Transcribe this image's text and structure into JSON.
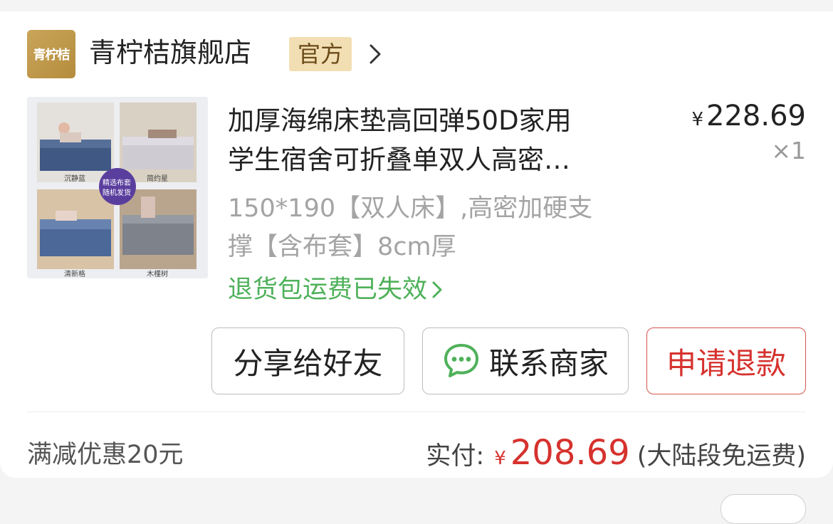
{
  "store": {
    "logo_text": "青柠桔",
    "name": "青柠桔旗舰店",
    "badge": "官方"
  },
  "product": {
    "title_line1": "加厚海绵床垫高回弹50D家用",
    "title_line2": "学生宿舍可折叠单双人高密…",
    "price_symbol": "¥",
    "price": "228.69",
    "quantity": "×1",
    "spec_line1": "150*190【双人床】,高密加硬支",
    "spec_line2": "撑【含布套】8cm厚",
    "return_notice": "退货包运费已失效",
    "image_labels": [
      "沉静蓝",
      "简约星",
      "精选布套",
      "随机发货",
      "清新格",
      "木槿树"
    ]
  },
  "actions": {
    "share": "分享给好友",
    "contact": "联系商家",
    "refund": "申请退款"
  },
  "summary": {
    "discount": "满减优惠20元",
    "paid_label": "实付:",
    "paid_symbol": "¥",
    "paid_amount": "208.69",
    "shipping_note": "(大陆段免运费)"
  },
  "colors": {
    "accent_red": "#d6322e",
    "green": "#4fb15a",
    "badge_bg": "#f2deb3",
    "logo_gold": "#c9a55a"
  },
  "icons": [
    "chevron-right-icon",
    "chat-bubble-icon"
  ]
}
